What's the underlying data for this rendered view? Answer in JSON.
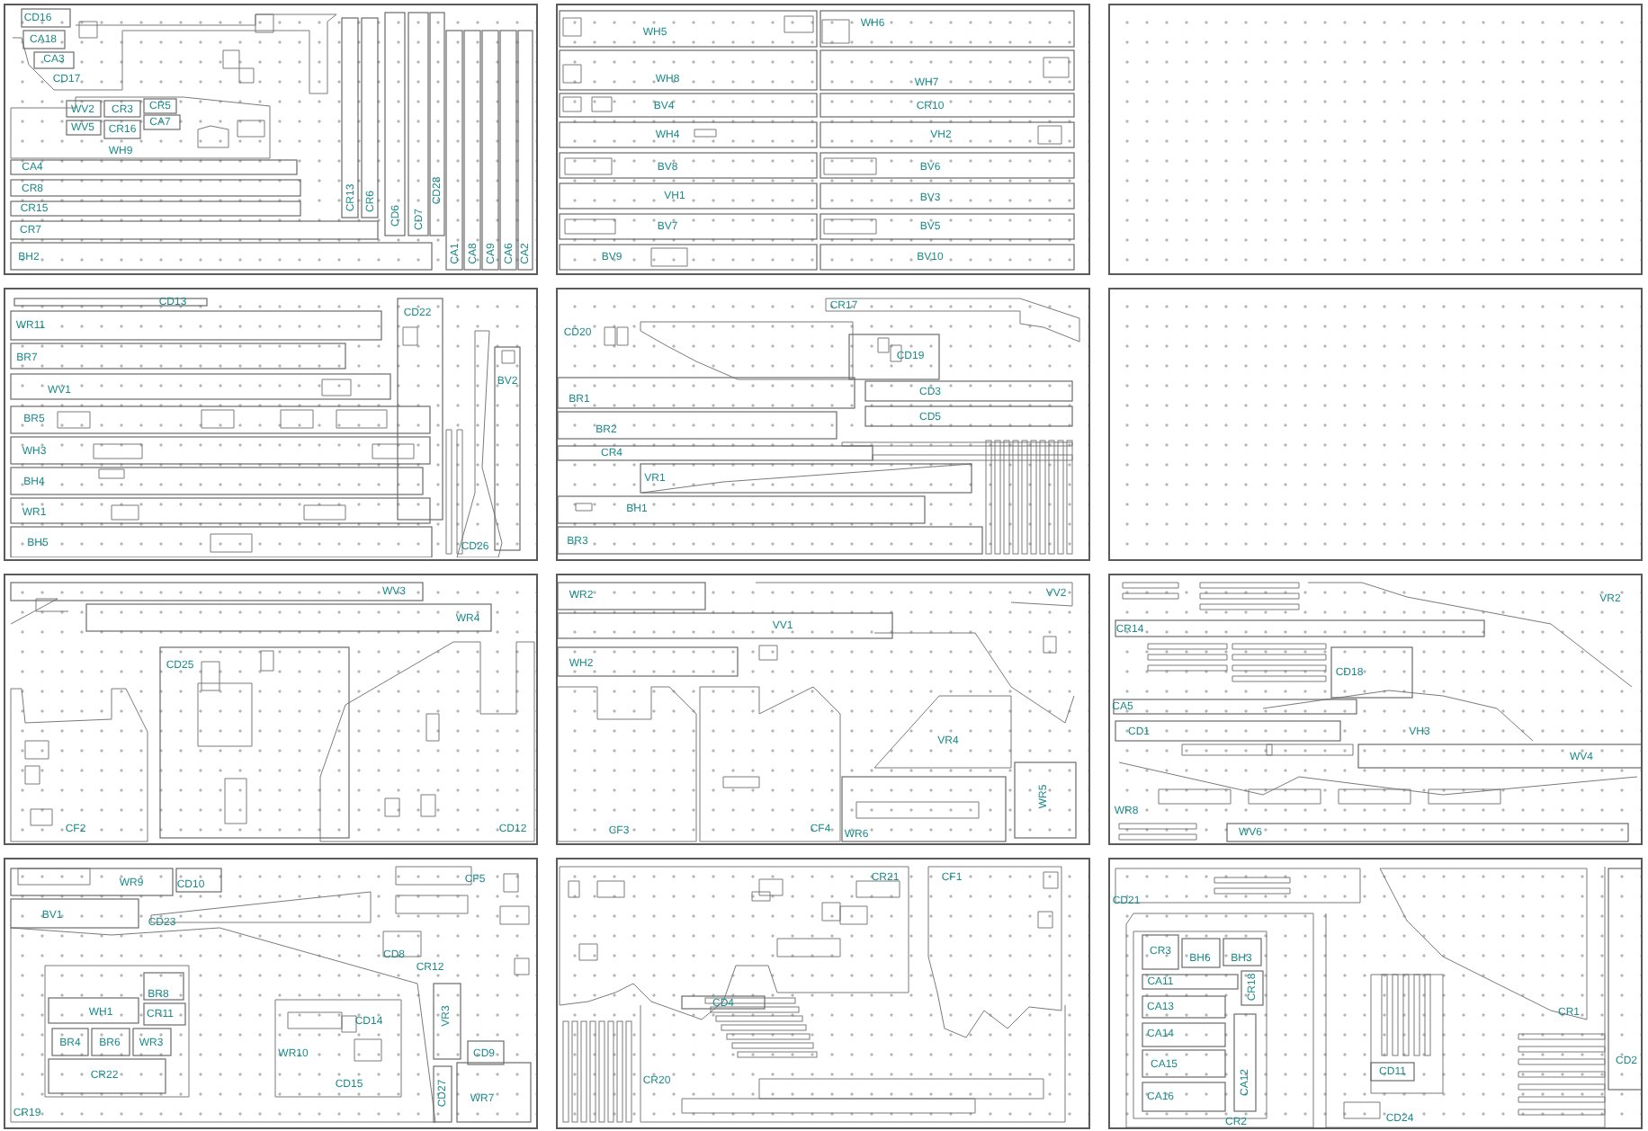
{
  "sheets": [
    {
      "kind": "nested",
      "labels": [
        "CD16",
        "CA18",
        "CA3",
        "CD17",
        "WV2",
        "WV5",
        "CR3",
        "CR16",
        "CR5",
        "CA7",
        "WH9",
        "CA4",
        "CR8",
        "CR15",
        "CR7",
        "BH2",
        "CR13",
        "CR6",
        "CD6",
        "CD7",
        "CD28",
        "CA1",
        "CA8",
        "CA9",
        "CA6",
        "CA2"
      ]
    },
    {
      "kind": "nested",
      "labels": [
        "WH5",
        "WH8",
        "BV4",
        "WH4",
        "BV8",
        "VH1",
        "BV7",
        "BV9",
        "WH6",
        "WH7",
        "CR10",
        "VH2",
        "BV6",
        "BV3",
        "BV5",
        "BV10"
      ]
    },
    {
      "kind": "blank"
    },
    {
      "kind": "nested",
      "labels": [
        "CD13",
        "WR11",
        "BR7",
        "WV1",
        "BR5",
        "WH3",
        "BH4",
        "WR1",
        "BH5",
        "CD22",
        "CD26",
        "BV2"
      ]
    },
    {
      "kind": "nested",
      "labels": [
        "CR17",
        "CD20",
        "CD19",
        "BR1",
        "BR2",
        "CD3",
        "CD5",
        "CR4",
        "VR1",
        "BH1",
        "BR3"
      ]
    },
    {
      "kind": "blank"
    },
    {
      "kind": "nested",
      "labels": [
        "WV3",
        "WR4",
        "CD25",
        "CF2",
        "CD12"
      ]
    },
    {
      "kind": "nested",
      "labels": [
        "WR2",
        "VV2",
        "VV1",
        "WH2",
        "VR4",
        "WR5",
        "CF3",
        "CF4",
        "WR6"
      ]
    },
    {
      "kind": "nested",
      "labels": [
        "VR2",
        "CR14",
        "CD18",
        "CA5",
        "CD1",
        "VH3",
        "WV4",
        "WR8",
        "WV6"
      ]
    },
    {
      "kind": "nested",
      "labels": [
        "WR9",
        "CD10",
        "BV1",
        "CD23",
        "CF5",
        "CD8",
        "CR12",
        "WH1",
        "BR8",
        "CR11",
        "BR4",
        "BR6",
        "WR3",
        "CR22",
        "CR19",
        "VR3",
        "CD14",
        "WR10",
        "CD15",
        "CD9",
        "CD27",
        "WR7"
      ]
    },
    {
      "kind": "nested",
      "labels": [
        "CR21",
        "CF1",
        "CD4",
        "CR20"
      ]
    },
    {
      "kind": "nested",
      "labels": [
        "CD21",
        "CR3",
        "BH6",
        "BH3",
        "CA11",
        "CR18",
        "CA13",
        "CA14",
        "CA15",
        "CA16",
        "CA12",
        "CR2",
        "CR1",
        "CD2",
        "CD11",
        "CD24"
      ]
    }
  ]
}
